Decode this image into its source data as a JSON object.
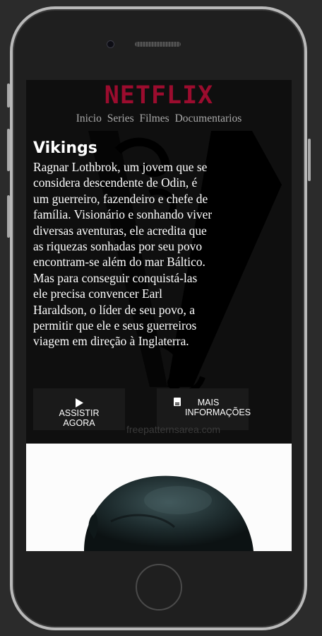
{
  "app": {
    "logo": "NETFLIX",
    "brand_color": "#9b0c2e"
  },
  "nav": {
    "items": [
      "Inicio",
      "Series",
      "Filmes",
      "Documentarios"
    ]
  },
  "show": {
    "title": "Vikings",
    "description": "Ragnar Lothbrok, um jovem que se considera descendente de Odin, é um guerreiro, fazendeiro e chefe de família. Visionário e sonhando viver diversas aventuras, ele acredita que as riquezas sonhadas por seu povo encontram-se além do mar Báltico. Mas para conseguir conquistá-las ele precisa convencer Earl Haraldson, o líder de seu povo, a permitir que ele e seus guerreiros viagem em direção à Inglaterra."
  },
  "buttons": {
    "play_icon": "play-icon",
    "play_label": "ASSISTIR AGORA",
    "info_icon": "document-icon",
    "info_label": "MAIS INFORMAÇÕES"
  },
  "watermark": "freepatternsarea.com"
}
